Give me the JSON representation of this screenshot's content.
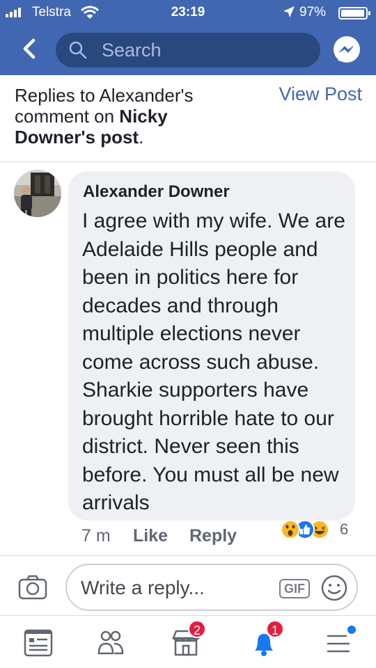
{
  "status_bar": {
    "carrier": "Telstra",
    "time": "23:19",
    "battery": "97%",
    "battery_level": 0.97
  },
  "nav": {
    "search_placeholder": "Search",
    "accent_color": "#4267b2"
  },
  "header": {
    "text_prefix": "Replies to Alexander's comment on ",
    "post_owner": "Nicky Downer",
    "text_suffix": "'s post",
    "text_end": ".",
    "view_post": "View Post"
  },
  "comment": {
    "author": "Alexander Downer",
    "text": "I agree with my wife. We are Adelaide Hills people and been in politics here for decades and through multiple elections never come across such abuse. Sharkie supporters have brought horrible hate to our district. Never seen this before. You must all be new arrivals",
    "time": "7 m",
    "like": "Like",
    "reply": "Reply",
    "reaction_count": "6",
    "reactions": [
      "wow-icon",
      "like-icon",
      "haha-icon"
    ]
  },
  "composer": {
    "placeholder": "Write a reply...",
    "gif": "GIF"
  },
  "tabbar": {
    "tabs": [
      {
        "icon": "news-feed-icon",
        "badge": ""
      },
      {
        "icon": "friends-icon",
        "badge": ""
      },
      {
        "icon": "marketplace-icon",
        "badge": "2"
      },
      {
        "icon": "notifications-icon",
        "badge": "1"
      },
      {
        "icon": "menu-icon",
        "badge": ""
      }
    ]
  }
}
